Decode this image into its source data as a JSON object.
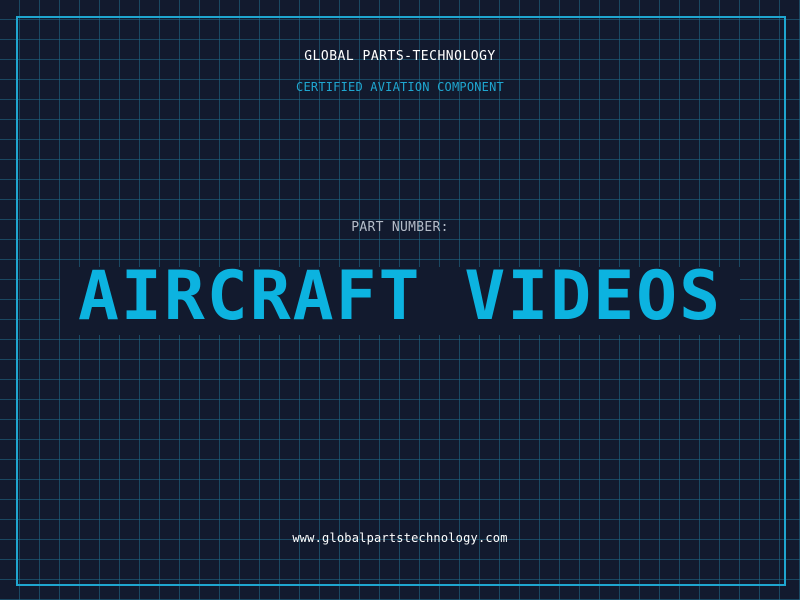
{
  "header": {
    "brand": "GLOBAL PARTS-TECHNOLOGY",
    "subtitle": "CERTIFIED AVIATION COMPONENT"
  },
  "part": {
    "label": "PART NUMBER:",
    "value": "AIRCRAFT VIDEOS"
  },
  "footer": {
    "website": "www.globalpartstechnology.com"
  },
  "colors": {
    "background": "#121a2e",
    "grid": "#226e8c",
    "accent": "#0cb3e0",
    "frame": "#1fa6d0",
    "text": "#ffffff",
    "muted_text": "#b5bcc8"
  }
}
